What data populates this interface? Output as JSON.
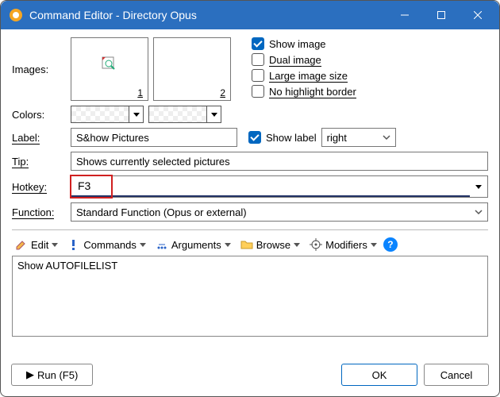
{
  "window": {
    "title": "Command Editor - Directory Opus",
    "min": "minimize",
    "max": "maximize",
    "close": "close"
  },
  "images": {
    "label": "Images:",
    "slots": [
      {
        "idx": "1"
      },
      {
        "idx": "2"
      }
    ]
  },
  "imageOptions": {
    "showImage": {
      "label": "Show image",
      "checked": true
    },
    "dualImage": {
      "label": "Dual image",
      "checked": false
    },
    "largeSize": {
      "label": "Large image size",
      "checked": false
    },
    "noHighlight": {
      "label": "No highlight border",
      "checked": false
    }
  },
  "colors": {
    "label": "Colors:"
  },
  "labelRow": {
    "label": "Label:",
    "value": "S&how Pictures",
    "showLabel": {
      "label": "Show label",
      "checked": true
    },
    "position": "right"
  },
  "tip": {
    "label": "Tip:",
    "value": "Shows currently selected pictures"
  },
  "hotkey": {
    "label": "Hotkey:",
    "value": "F3"
  },
  "func": {
    "label": "Function:",
    "value": "Standard Function (Opus or external)"
  },
  "toolbar": {
    "edit": "Edit",
    "commands": "Commands",
    "arguments": "Arguments",
    "browse": "Browse",
    "modifiers": "Modifiers"
  },
  "script": "Show AUTOFILELIST",
  "footer": {
    "run": "Run (F5)",
    "ok": "OK",
    "cancel": "Cancel"
  }
}
